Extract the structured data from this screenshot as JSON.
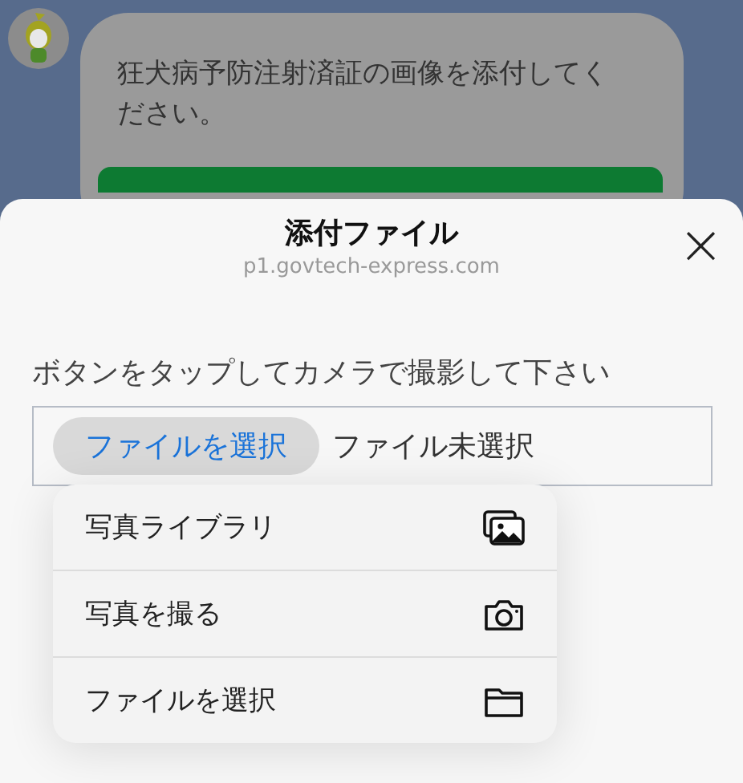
{
  "chat": {
    "message": "狂犬病予防注射済証の画像を添付してください。"
  },
  "sheet": {
    "title": "添付ファイル",
    "subtitle": "p1.govtech-express.com",
    "close": "×"
  },
  "prompt": "ボタンをタップしてカメラで撮影して下さい",
  "file_input": {
    "button": "ファイルを選択",
    "status": "ファイル未選択"
  },
  "menu": [
    {
      "label": "写真ライブラリ",
      "kind": "photos"
    },
    {
      "label": "写真を撮る",
      "kind": "camera"
    },
    {
      "label": "ファイルを選択",
      "kind": "folder"
    }
  ]
}
